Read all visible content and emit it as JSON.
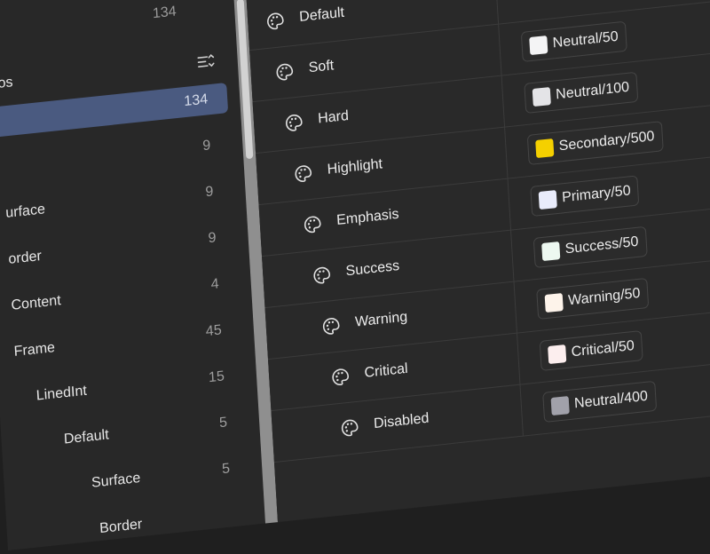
{
  "sidebar": {
    "prev_count": "134",
    "section_label": "os",
    "sort_icon": "sort-lines-icon",
    "items": [
      {
        "label": "",
        "count": "134",
        "selected": true
      },
      {
        "label": "",
        "count": "9"
      },
      {
        "label": "urface",
        "count": "9"
      },
      {
        "label": "order",
        "count": "9"
      },
      {
        "label": "Content",
        "count": "4"
      },
      {
        "label": "Frame",
        "count": "45"
      },
      {
        "label": "LinedInt",
        "count": "15"
      },
      {
        "label": "Default",
        "count": "5"
      },
      {
        "label": "Surface",
        "count": "5"
      },
      {
        "label": "Border",
        "count": ""
      }
    ]
  },
  "table": {
    "row_icon": "palette-icon",
    "rows": [
      {
        "name": "Default",
        "value": "",
        "swatch": "#ffffff"
      },
      {
        "name": "Soft",
        "value": "Neutral/50",
        "swatch": "#f4f4f5"
      },
      {
        "name": "Hard",
        "value": "Neutral/100",
        "swatch": "#e4e4e7"
      },
      {
        "name": "Highlight",
        "value": "Secondary/500",
        "swatch": "#f5d000"
      },
      {
        "name": "Emphasis",
        "value": "Primary/50",
        "swatch": "#e9ecfb"
      },
      {
        "name": "Success",
        "value": "Success/50",
        "swatch": "#edf8f1"
      },
      {
        "name": "Warning",
        "value": "Warning/50",
        "swatch": "#fdf3ea"
      },
      {
        "name": "Critical",
        "value": "Critical/50",
        "swatch": "#fceeee"
      },
      {
        "name": "Disabled",
        "value": "Neutral/400",
        "swatch": "#a1a1aa"
      }
    ]
  }
}
